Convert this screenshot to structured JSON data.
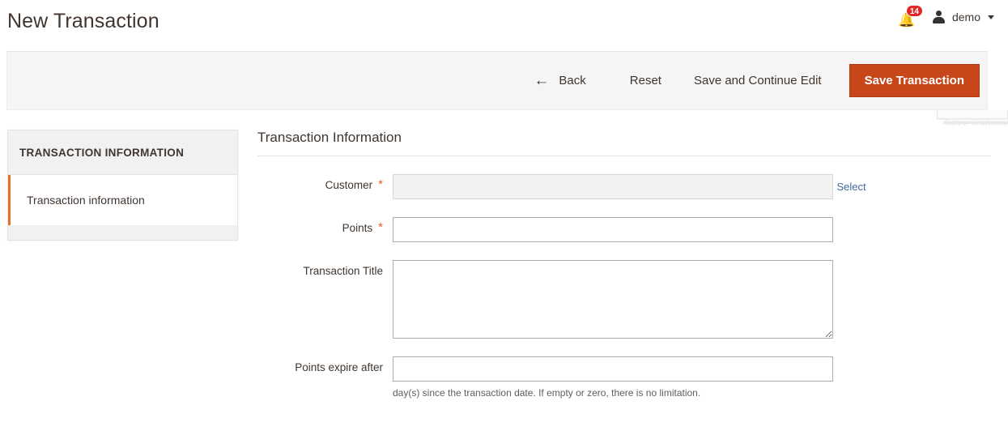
{
  "header": {
    "title": "New Transaction",
    "notifications": {
      "icon": "bell-icon",
      "count": "14"
    },
    "user": {
      "icon": "user-avatar-icon",
      "name": "demo",
      "caret": "chevron-down-icon"
    }
  },
  "toolbar": {
    "back_icon": "arrow-left-icon",
    "back_label": "Back",
    "reset_label": "Reset",
    "save_continue_label": "Save and Continue Edit",
    "save_label": "Save Transaction",
    "primary_color": "#c7461a"
  },
  "sticky_ghost": {
    "label": "Save Transaction"
  },
  "sidebar": {
    "title": "TRANSACTION INFORMATION",
    "items": [
      {
        "label": "Transaction information",
        "active": true
      }
    ],
    "active_accent": "#e3702b"
  },
  "main": {
    "section_title": "Transaction Information",
    "fields": [
      {
        "label": "Customer",
        "required": true,
        "required_mark": "*",
        "value": "",
        "disabled": true,
        "link_label": "Select"
      },
      {
        "label": "Points",
        "required": true,
        "required_mark": "*",
        "value": ""
      },
      {
        "label": "Transaction Title",
        "required": false,
        "value": ""
      },
      {
        "label": "Points expire after",
        "required": false,
        "value": "",
        "note": "day(s) since the transaction date. If empty or zero, there is no limitation."
      }
    ]
  }
}
